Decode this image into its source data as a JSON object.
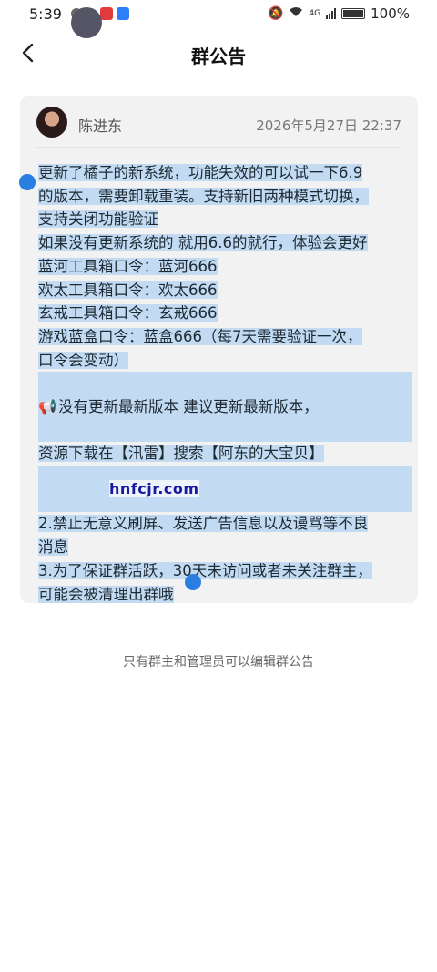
{
  "status": {
    "time": "5:39",
    "battery": "100%",
    "network": "4G"
  },
  "header": {
    "title": "群公告"
  },
  "post": {
    "author": "陈进东",
    "timestamp": "2026年5月27日 22:37",
    "lines": [
      "更新了橘子的新系统，功能失效的可以试一下6.9",
      "的版本，需要卸载重装。支持新旧两种模式切换，",
      "支持关闭功能验证",
      "如果没有更新系统的 就用6.6的就行，体验会更好",
      "蓝河工具箱口令：蓝河666",
      "欢太工具箱口令：欢太666",
      "玄戒工具箱口令：玄戒666",
      "游戏蓝盒口令：蓝盒666（每7天需要验证一次，",
      "口令会变动）",
      "",
      "没有更新最新版本 建议更新最新版本，",
      "",
      "资源下载在【汛雷】搜索【阿东的大宝贝】",
      "",
      "",
      "2.禁止无意义刷屏、发送广告信息以及谩骂等不良",
      "消息",
      "3.为了保证群活跃，30天未访问或者未关注群主，",
      "可能会被清理出群哦"
    ]
  },
  "watermark": "hnfcjr.com",
  "footer": {
    "note": "只有群主和管理员可以编辑群公告"
  }
}
